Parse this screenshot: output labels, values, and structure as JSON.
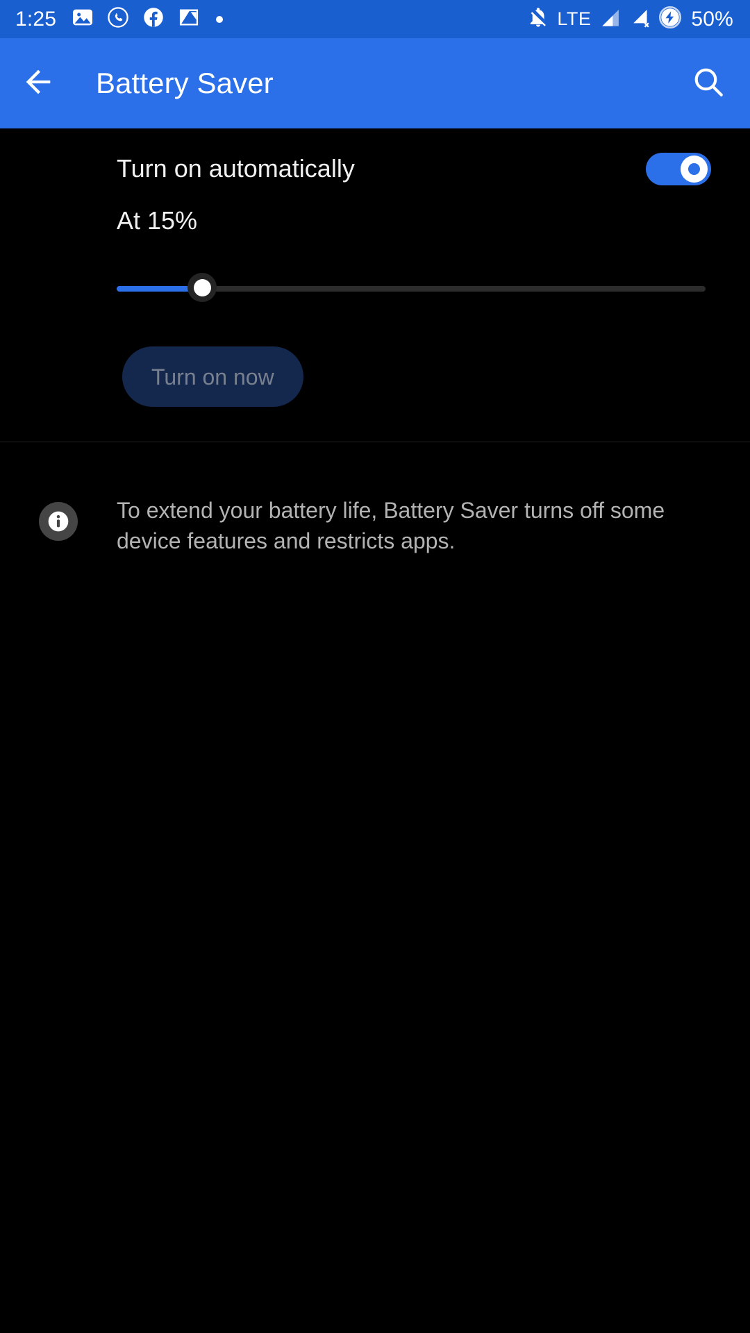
{
  "status_bar": {
    "time": "1:25",
    "network_type": "LTE",
    "battery_percent": "50%",
    "left_icons": [
      {
        "name": "photos-icon"
      },
      {
        "name": "whatsapp-icon"
      },
      {
        "name": "facebook-icon"
      },
      {
        "name": "screenshot-icon"
      },
      {
        "name": "more-notifications-dot-icon"
      }
    ],
    "right_icons": [
      {
        "name": "notifications-silenced-icon"
      },
      {
        "name": "signal-bars-icon"
      },
      {
        "name": "signal-no-service-icon"
      },
      {
        "name": "battery-charging-icon"
      }
    ],
    "background_color": "#1a5fd0"
  },
  "app_bar": {
    "title": "Battery Saver",
    "back_icon": "arrow-back-icon",
    "search_icon": "search-icon",
    "background_color": "#2b70e8"
  },
  "settings": {
    "auto_toggle": {
      "label": "Turn on automatically",
      "state": "on",
      "accent_color": "#2b70e8"
    },
    "threshold": {
      "label": "At 15%",
      "value": 15,
      "min": 0,
      "max": 100,
      "fill_color": "#2b70e8",
      "track_color": "#2c2c2c"
    },
    "turn_on_now_button": {
      "label": "Turn on now",
      "background_color": "#14274d",
      "text_color": "#78808f"
    }
  },
  "footer": {
    "info_icon": "info-icon",
    "text": "To extend your battery life, Battery Saver turns off some device features and restricts apps."
  }
}
